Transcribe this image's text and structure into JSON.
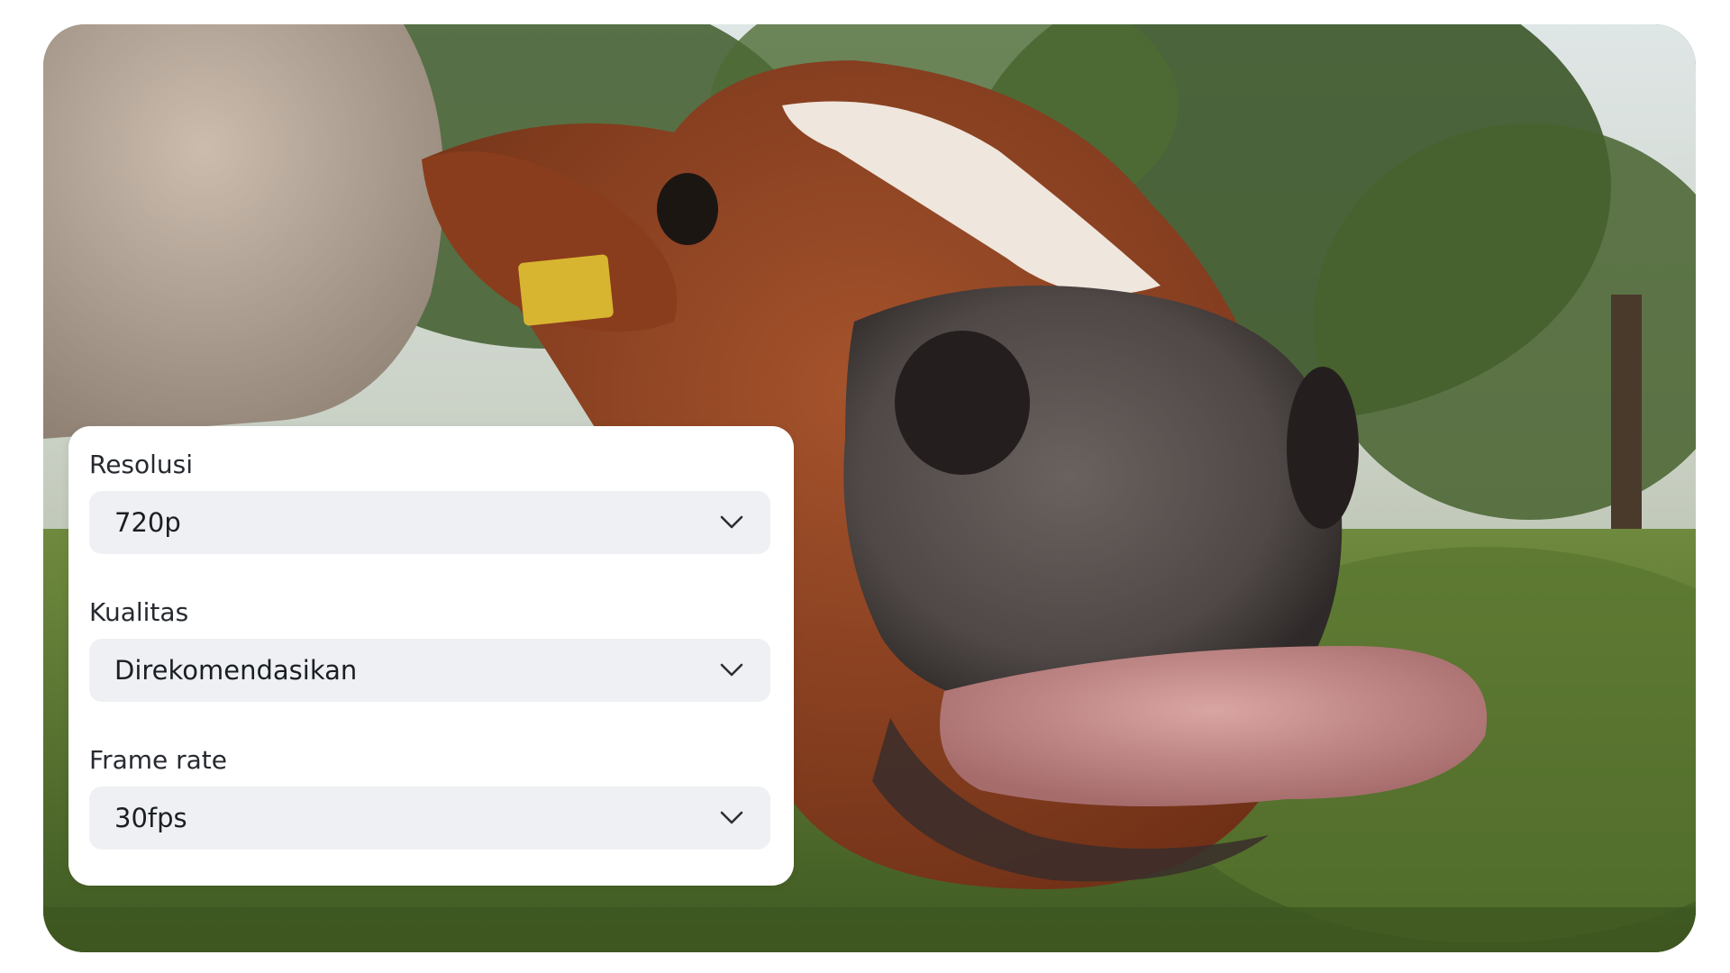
{
  "settings": {
    "resolution": {
      "label": "Resolusi",
      "value": "720p"
    },
    "quality": {
      "label": "Kualitas",
      "value": "Direkomendasikan"
    },
    "frame_rate": {
      "label": "Frame rate",
      "value": "30fps"
    }
  },
  "icons": {
    "dropdown": "chevron-down-icon"
  },
  "colors": {
    "panel_background": "#ffffff",
    "select_background": "#eef0f3",
    "text": "#1b1f24"
  }
}
